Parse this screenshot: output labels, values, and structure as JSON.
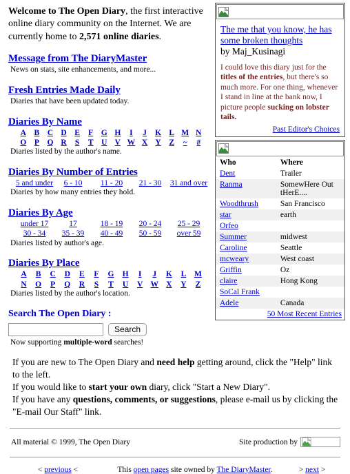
{
  "intro": {
    "bold_lead": "Welcome to The Open Diary",
    "text_1": ", the first interactive online diary community on the Internet. We are currently home to ",
    "bold_count": "2,571 online diaries",
    "text_2": "."
  },
  "sections": [
    {
      "heading": "Message from The DiaryMaster",
      "note": "News on stats, site enhancements, and more..."
    },
    {
      "heading": "Fresh Entries Made Daily",
      "note": "Diaries that have been updated today."
    },
    {
      "heading": "Diaries By Name",
      "note": "Diaries listed by the author's name.",
      "rows": [
        [
          "A",
          "B",
          "C",
          "D",
          "E",
          "F",
          "G",
          "H",
          "I",
          "J",
          "K",
          "L",
          "M",
          "N"
        ],
        [
          "O",
          "P",
          "Q",
          "R",
          "S",
          "T",
          "U",
          "V",
          "W",
          "X",
          "Y",
          "Z",
          "~",
          "#"
        ]
      ]
    },
    {
      "heading": "Diaries By Number of Entries",
      "note": "Diaries by how many entries they hold.",
      "rows": [
        [
          "5 and under",
          "6 - 10",
          "11 - 20",
          "21 - 30",
          "31 and over"
        ]
      ]
    },
    {
      "heading": "Diaries By Age",
      "note": "Diaries listed by author's age.",
      "rows": [
        [
          "under 17",
          "17",
          "18 - 19",
          "20 - 24",
          "25 - 29"
        ],
        [
          "30 - 34",
          "35 - 39",
          "40 - 49",
          "50 - 59",
          "over 59"
        ]
      ]
    },
    {
      "heading": "Diaries By Place",
      "note": "Diaries listed by the author's location.",
      "rows": [
        [
          "A",
          "B",
          "C",
          "D",
          "E",
          "F",
          "G",
          "H",
          "I",
          "J",
          "K",
          "L",
          "M"
        ],
        [
          "N",
          "O",
          "P",
          "Q",
          "R",
          "S",
          "T",
          "U",
          "V",
          "W",
          "X",
          "Y",
          "Z"
        ]
      ]
    }
  ],
  "search": {
    "title": "Search The Open Diary :",
    "value": "",
    "placeholder": "",
    "button_label": "Search",
    "note_pre": "Now supporting ",
    "note_bold": "multiple-word",
    "note_post": " searches!"
  },
  "editors_choice": {
    "title": "The me that you know, he has some broken thoughts",
    "byline": "by Maj_Kusinagi",
    "blurb_1": "I could love this diary just for the ",
    "blurb_b1": "titles of the entries",
    "blurb_2": ", but there's so much more. For one thing, whenever I stand in line at the bank now, I picture people ",
    "blurb_b2": "sucking on lobster tails.",
    "past_link": "Past Editor's Choices"
  },
  "recent": {
    "columns": [
      "Who",
      "Where"
    ],
    "rows": [
      {
        "who": "Dent",
        "where": "Trailer"
      },
      {
        "who": "Ranma",
        "where": "SomewHere Out tHerE...."
      },
      {
        "who": "Woodthrush",
        "where": "San Francisco"
      },
      {
        "who": "star",
        "where": "earth"
      },
      {
        "who": "Orfeo",
        "where": ""
      },
      {
        "who": "Summer",
        "where": "midwest"
      },
      {
        "who": "Caroline",
        "where": "Seattle"
      },
      {
        "who": "mcweary",
        "where": "West coast"
      },
      {
        "who": "Griffin",
        "where": "Oz"
      },
      {
        "who": "claire",
        "where": "Hong Kong"
      },
      {
        "who": "SoCal Frank",
        "where": ""
      },
      {
        "who": "Adele",
        "where": "Canada"
      }
    ],
    "footer_link": "50 Most Recent Entries"
  },
  "instructions": {
    "l1_a": "If you are new to The Open Diary and ",
    "l1_b": "need help",
    "l1_c": " getting around, click the \"Help\" link to the left.",
    "l2_a": "If you would like to ",
    "l2_b": "start your own",
    "l2_c": " diary, click \"Start a New Diary\".",
    "l3_a": "If you have any ",
    "l3_b": "questions, comments, or suggestions",
    "l3_c": ", please e-mail us by clicking the \"E-mail Our Staff\" link."
  },
  "footer": {
    "copyright": "All material © 1999, The Open Diary",
    "production_label": "Site production by",
    "prev": "previous",
    "prev_pre": "< ",
    "prev_post": " <",
    "mid_pre": "This ",
    "mid_link": "open pages",
    "mid_mid": " site owned by ",
    "mid_link2": "The DiaryMaster",
    "mid_post": ".",
    "next": "next",
    "next_pre": "> ",
    "next_post": " >"
  },
  "colors": {
    "link": "#0000cc",
    "blurb": "#772222",
    "alt_row": "#f0f0f0",
    "border": "#555555"
  }
}
